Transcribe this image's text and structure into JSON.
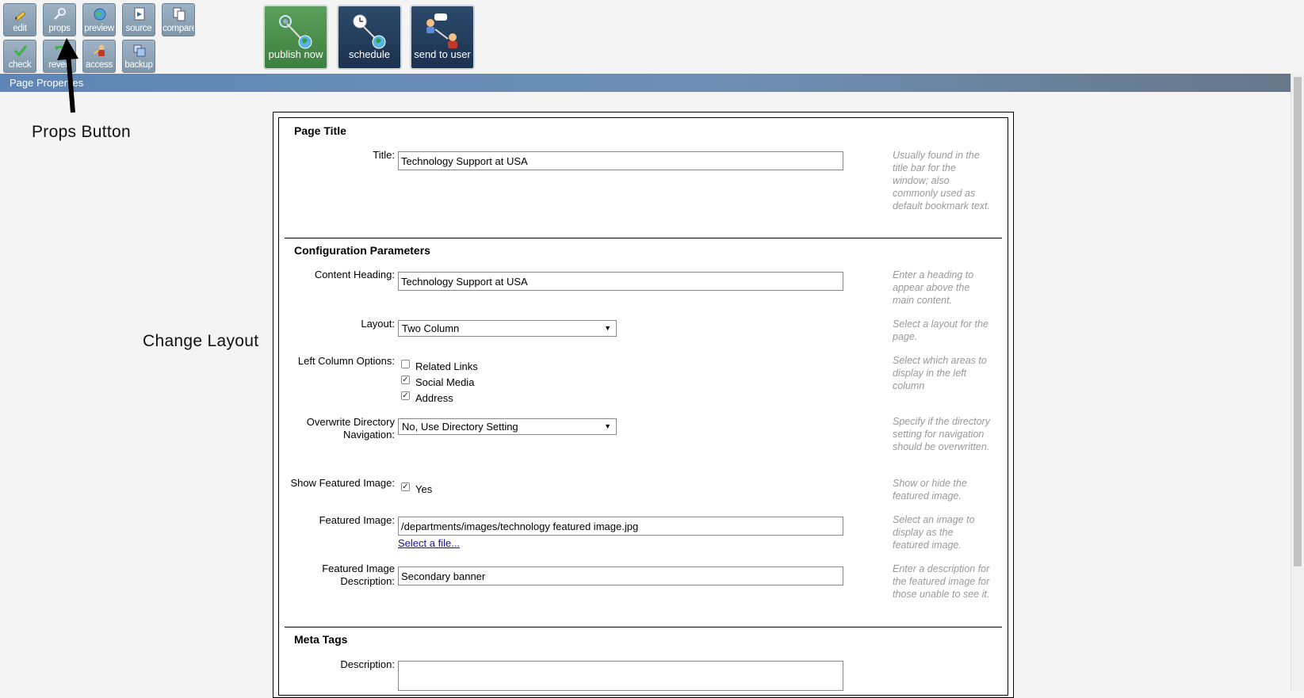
{
  "toolbar": {
    "small_buttons": [
      {
        "label": "edit",
        "icon": "pencil-icon"
      },
      {
        "label": "props",
        "icon": "tools-icon"
      },
      {
        "label": "preview",
        "icon": "globe-icon"
      },
      {
        "label": "source",
        "icon": "source-icon"
      },
      {
        "label": "compare",
        "icon": "compare-icon"
      },
      {
        "label": "check",
        "icon": "checkmark-icon"
      },
      {
        "label": "revert",
        "icon": "revert-icon"
      },
      {
        "label": "access",
        "icon": "access-icon"
      },
      {
        "label": "backup",
        "icon": "backup-icon"
      }
    ],
    "big_buttons": [
      {
        "label": "publish now",
        "icon": "publish-icon",
        "color": "#4a8f4c"
      },
      {
        "label": "schedule",
        "icon": "schedule-icon",
        "color": "#22395a"
      },
      {
        "label": "send to user",
        "icon": "send-to-user-icon",
        "color": "#22395a"
      }
    ]
  },
  "titlebar": {
    "title": "Page Properties"
  },
  "annotations": {
    "props": "Props Button",
    "layout": "Change Layout"
  },
  "sections": {
    "page_title": "Page Title",
    "config": "Configuration Parameters",
    "meta": "Meta Tags"
  },
  "fields": {
    "title": {
      "label": "Title:",
      "value": "Technology Support at USA",
      "help": "Usually found in the title bar for the window; also commonly used as default bookmark text."
    },
    "content_heading": {
      "label": "Content Heading:",
      "value": "Technology Support at USA",
      "help": "Enter a heading to appear above the main content."
    },
    "layout": {
      "label": "Layout:",
      "value": "Two Column",
      "help": "Select a layout for the page."
    },
    "left_column": {
      "label": "Left Column Options:",
      "help": "Select which areas to display in the left column",
      "options": [
        {
          "label": "Related Links",
          "checked": false
        },
        {
          "label": "Social Media",
          "checked": true
        },
        {
          "label": "Address",
          "checked": true
        }
      ]
    },
    "overwrite_nav": {
      "label": "Overwrite Directory Navigation:",
      "value": "No, Use Directory Setting",
      "help": "Specify if the directory setting for navigation should be overwritten."
    },
    "show_featured": {
      "label": "Show Featured Image:",
      "option": "Yes",
      "checked": true,
      "help": "Show or hide the featured image."
    },
    "featured_image": {
      "label": "Featured Image:",
      "value": "/departments/images/technology featured image.jpg",
      "link": "Select a file...",
      "help": "Select an image to display as the featured image."
    },
    "featured_desc": {
      "label": "Featured Image Description:",
      "value": "Secondary banner",
      "help": "Enter a description for the featured image for those unable to see it."
    },
    "description": {
      "label": "Description:"
    }
  }
}
